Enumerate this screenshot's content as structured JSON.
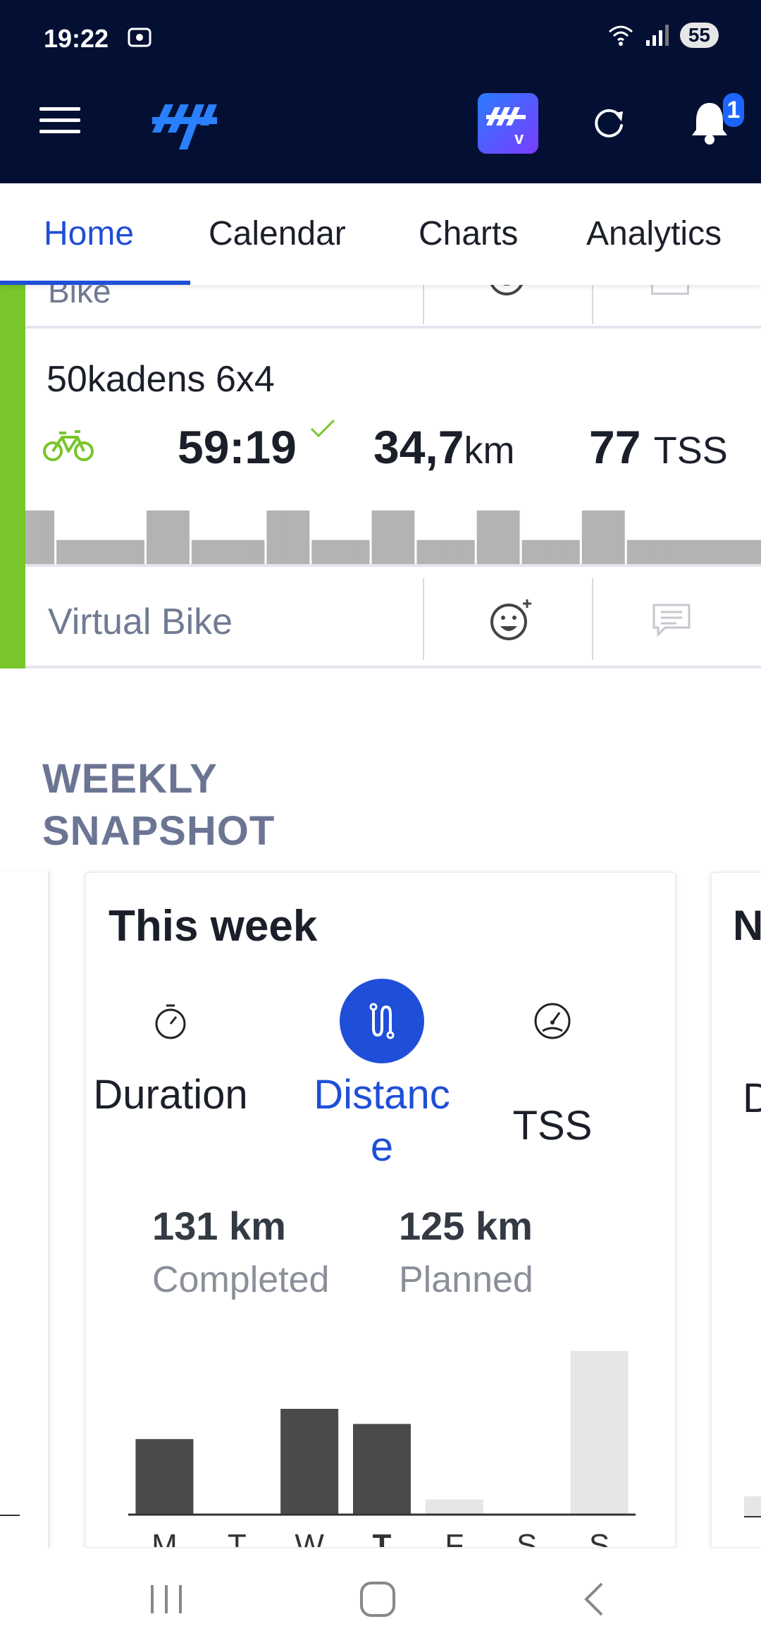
{
  "status": {
    "time": "19:22",
    "battery": "55"
  },
  "header": {
    "notification_count": "1"
  },
  "tabs": [
    {
      "label": "Home",
      "active": true
    },
    {
      "label": "Calendar",
      "active": false
    },
    {
      "label": "Charts",
      "active": false
    },
    {
      "label": "Analytics",
      "active": false
    }
  ],
  "previous_workout": {
    "type_label": "Bike"
  },
  "workout": {
    "title": "50kadens 6x4",
    "duration": "59:19",
    "distance_value": "34,7",
    "distance_unit": "km",
    "tss_value": "77",
    "tss_unit": "TSS",
    "type_label": "Virtual Bike",
    "sport_color": "#78c62b",
    "profile_blocks": [
      1,
      1,
      0.45,
      0.45,
      0.45,
      0.45,
      0.45,
      0.45,
      1,
      1,
      1,
      0.45,
      0.45,
      0.45,
      0.45,
      0.45,
      1,
      1,
      1,
      0.45,
      0.45,
      0.45,
      0.45,
      1,
      1,
      1,
      0.45,
      0.45,
      0.45,
      0.45,
      1,
      1,
      1,
      0.45,
      0.45,
      0.45,
      0.45,
      1,
      1,
      1,
      0.45,
      0.45,
      0.45,
      0.45,
      0.45,
      0.45,
      0.45,
      0.45,
      0.45
    ]
  },
  "weekly_snapshot": {
    "title_line1": "WEEKLY",
    "title_line2": "SNAPSHOT",
    "card_title": "This week",
    "next_card_title": "N",
    "next_card_sub": "D",
    "modes": [
      {
        "label": "Duration",
        "icon": "stopwatch-icon",
        "active": false
      },
      {
        "label": "Distance",
        "icon": "route-icon",
        "active": true
      },
      {
        "label": "TSS",
        "icon": "gauge-icon",
        "active": false
      }
    ],
    "completed": {
      "value": "131 km",
      "label": "Completed"
    },
    "planned": {
      "value": "125 km",
      "label": "Planned"
    }
  },
  "chart_data": {
    "type": "bar",
    "categories": [
      "M",
      "T",
      "W",
      "T",
      "F",
      "S",
      "S"
    ],
    "series": [
      {
        "values": [
          30,
          0,
          42,
          36,
          0,
          0,
          0
        ]
      },
      {
        "values": [
          0,
          0,
          0,
          0,
          6,
          0,
          65
        ]
      }
    ],
    "colors": [
      "#4a4a4a",
      "#e6e6e6"
    ],
    "ylim": [
      0,
      70
    ]
  }
}
